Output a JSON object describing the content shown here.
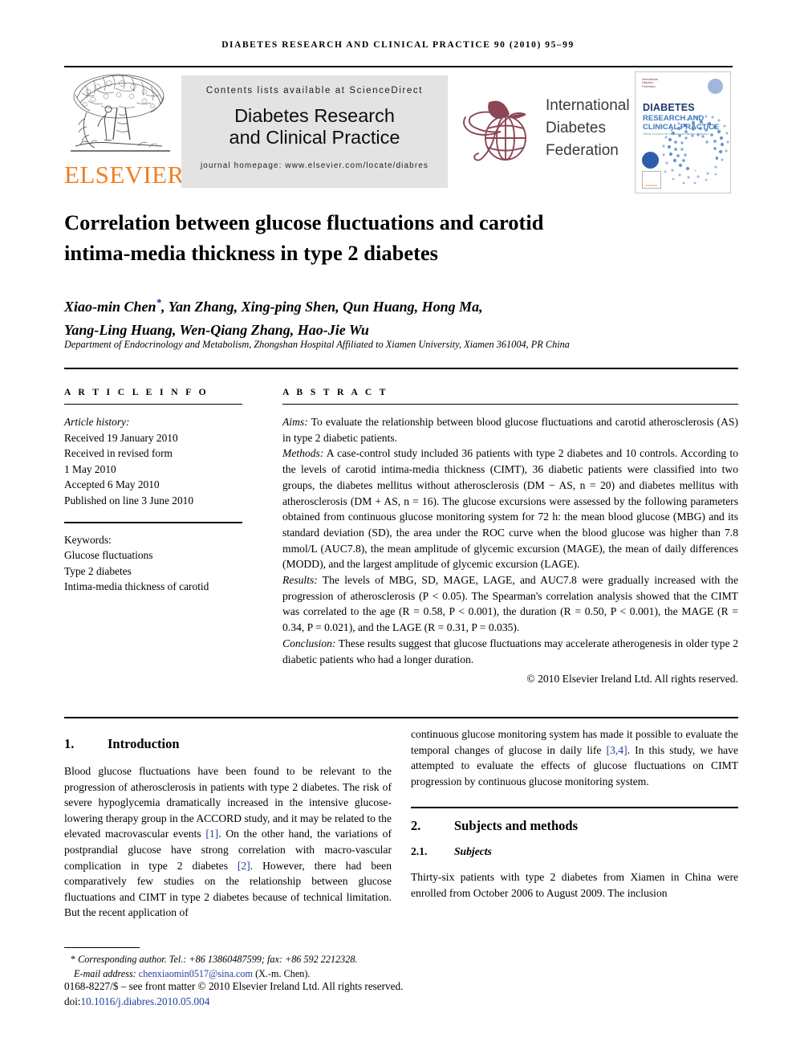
{
  "running_head": "DIABETES RESEARCH AND CLINICAL PRACTICE 90 (2010) 95–99",
  "masthead": {
    "publisher_word": "ELSEVIER",
    "banner_top": "Contents lists available at ScienceDirect",
    "banner_title_line1": "Diabetes Research",
    "banner_title_line2": "and Clinical Practice",
    "banner_homepage": "journal homepage: www.elsevier.com/locate/diabres",
    "idf_line1": "International",
    "idf_line2": "Diabetes",
    "idf_line3": "Federation",
    "cover": {
      "idf_mark_text": "International\nDiabetes\nFederation",
      "title_line1": "DIABETES",
      "title_line2": "RESEARCH AND",
      "title_line3": "CLINICAL PRACTICE",
      "subtitle": "Official Journal of the International Diabetes Federation",
      "elsevier_label": "ELSEVIER"
    }
  },
  "article": {
    "title_line1": "Correlation between glucose fluctuations and carotid",
    "title_line2": "intima-media thickness in type 2 diabetes",
    "authors_line1": "Xiao-min Chen",
    "authors_star": "*",
    "authors_line1b": ", Yan Zhang, Xing-ping Shen, Qun Huang, Hong Ma,",
    "authors_line2": "Yang-Ling Huang, Wen-Qiang Zhang, Hao-Jie Wu",
    "affiliation": "Department of Endocrinology and Metabolism, Zhongshan Hospital Affiliated to Xiamen University, Xiamen 361004, PR China"
  },
  "article_info": {
    "heading": "A R T I C L E  I N F O",
    "history_label": "Article history:",
    "history": [
      "Received 19 January 2010",
      "Received in revised form",
      "1 May 2010",
      "Accepted 6 May 2010",
      "Published on line 3 June 2010"
    ],
    "keywords_label": "Keywords:",
    "keywords": [
      "Glucose fluctuations",
      "Type 2 diabetes",
      "Intima-media thickness of carotid"
    ]
  },
  "abstract": {
    "heading": "A B S T R A C T",
    "aims_label": "Aims:",
    "aims_text": " To evaluate the relationship between blood glucose fluctuations and carotid atherosclerosis (AS) in type 2 diabetic patients.",
    "methods_label": "Methods:",
    "methods_text": " A case-control study included 36 patients with type 2 diabetes and 10 controls. According to the levels of carotid intima-media thickness (CIMT), 36 diabetic patients were classified into two groups, the diabetes mellitus without atherosclerosis (DM − AS, n = 20) and diabetes mellitus with atherosclerosis (DM + AS, n = 16). The glucose excursions were assessed by the following parameters obtained from continuous glucose monitoring system for 72 h: the mean blood glucose (MBG) and its standard deviation (SD), the area under the ROC curve when the blood glucose was higher than 7.8 mmol/L (AUC7.8), the mean amplitude of glycemic excursion (MAGE), the mean of daily differences (MODD), and the largest amplitude of glycemic excursion (LAGE).",
    "results_label": "Results:",
    "results_text": " The levels of MBG, SD, MAGE, LAGE, and AUC7.8 were gradually increased with the progression of atherosclerosis (P < 0.05). The Spearman's correlation analysis showed that the CIMT was correlated to the age (R = 0.58, P < 0.001), the duration (R = 0.50, P < 0.001), the MAGE (R = 0.34, P = 0.021), and the LAGE (R = 0.31, P = 0.035).",
    "conclusion_label": "Conclusion:",
    "conclusion_text": " These results suggest that glucose fluctuations may accelerate atherogenesis in older type 2 diabetic patients who had a longer duration.",
    "copyright": "© 2010 Elsevier Ireland Ltd. All rights reserved."
  },
  "body": {
    "sec1_num": "1.",
    "sec1_title": "Introduction",
    "sec1_p1_a": "Blood glucose fluctuations have been found to be relevant to the progression of atherosclerosis in patients with type 2 diabetes. The risk of severe hypoglycemia dramatically increased in the intensive glucose-lowering therapy group in the ACCORD study, and it may be related to the elevated macrovascular events ",
    "sec1_cite1": "[1]",
    "sec1_p1_b": ". On the other hand, the variations of postprandial glucose have strong correlation with macro-vascular complication in type 2 diabetes ",
    "sec1_cite2": "[2]",
    "sec1_p1_c": ". However, there had been comparatively few studies on the relationship between glucose fluctuations and CIMT in type 2 diabetes because of technical limitation. But the recent application of",
    "sec1_p1_d": "continuous glucose monitoring system has made it possible to evaluate the temporal changes of glucose in daily life ",
    "sec1_cite3": "[3,4]",
    "sec1_p1_e": ". In this study, we have attempted to evaluate the effects of glucose fluctuations on CIMT progression by continuous glucose monitoring system.",
    "sec2_num": "2.",
    "sec2_title": "Subjects and methods",
    "sec21_num": "2.1.",
    "sec21_title": "Subjects",
    "sec21_p1": "Thirty-six patients with type 2 diabetes from Xiamen in China were enrolled from October 2006 to August 2009. The inclusion"
  },
  "footnote": {
    "star": "*",
    "corresponding": " Corresponding author. Tel.: +86 13860487599; fax: +86 592 2212328.",
    "email_label": "E-mail address: ",
    "email": "chenxiaomin0517@sina.com",
    "email_suffix": " (X.-m. Chen).",
    "frontmatter": "0168-8227/$ – see front matter © 2010 Elsevier Ireland Ltd. All rights reserved.",
    "doi_label": "doi:",
    "doi": "10.1016/j.diabres.2010.05.004"
  },
  "colors": {
    "elsevier_orange": "#F08022",
    "idf_maroon": "#8C4656",
    "link_blue": "#1F3F9E",
    "banner_gray": "#E3E3E3",
    "cover_navy": "#1B3A6B",
    "cover_blue": "#3F78BD"
  }
}
